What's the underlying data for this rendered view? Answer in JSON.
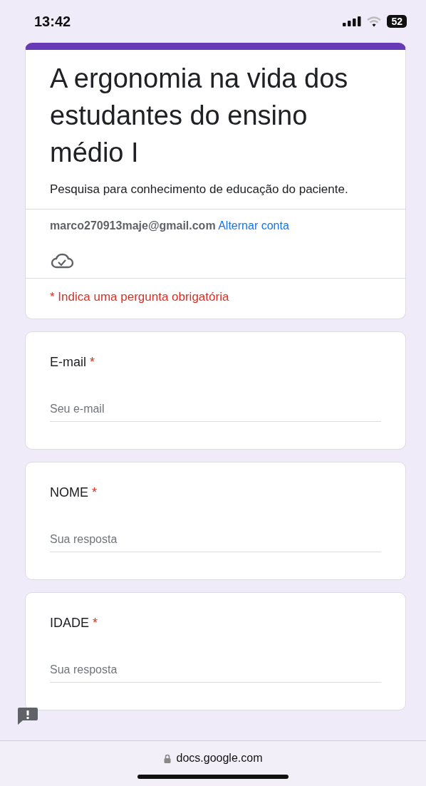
{
  "status_bar": {
    "time": "13:42",
    "battery": "52"
  },
  "form": {
    "title": "A ergonomia na vida dos estudantes do ensino médio I",
    "description": "Pesquisa para conhecimento de educação do paciente.",
    "account": "marco270913maje@gmail.com",
    "switch_account": "Alternar conta",
    "required_note": "* Indica uma pergunta obrigatória"
  },
  "questions": [
    {
      "label": "E-mail",
      "required_mark": "*",
      "placeholder": "Seu e-mail"
    },
    {
      "label": "NOME",
      "required_mark": "*",
      "placeholder": "Sua resposta"
    },
    {
      "label": "IDADE",
      "required_mark": "*",
      "placeholder": "Sua resposta"
    }
  ],
  "address_bar": {
    "url": "docs.google.com"
  }
}
